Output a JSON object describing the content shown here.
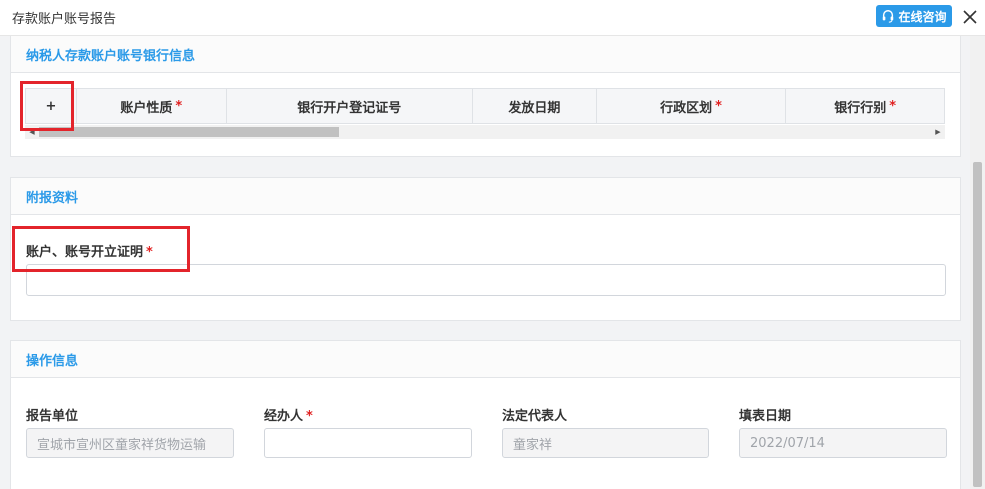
{
  "window": {
    "title": "存款账户账号报告",
    "consult_label": "在线咨询"
  },
  "bank_section": {
    "title": "纳税人存款账户账号银行信息",
    "add_label": "+",
    "columns": [
      {
        "label": "账户性质",
        "required": "*"
      },
      {
        "label": "银行开户登记证号",
        "required": ""
      },
      {
        "label": "发放日期",
        "required": ""
      },
      {
        "label": "行政区划",
        "required": "*"
      },
      {
        "label": "银行行别",
        "required": "*"
      }
    ]
  },
  "attach_section": {
    "title": "附报资料",
    "proof_label": "账户、账号开立证明",
    "proof_required": "*",
    "proof_value": ""
  },
  "op_section": {
    "title": "操作信息",
    "report_unit_label": "报告单位",
    "report_unit_value": "宣城市宣州区童家祥货物运输",
    "handler_label": "经办人",
    "handler_required": "*",
    "handler_value": "",
    "legal_rep_label": "法定代表人",
    "legal_rep_value": "童家祥",
    "fill_date_label": "填表日期",
    "fill_date_value": "2022/07/14"
  },
  "colors": {
    "accent": "#2b9ae8",
    "required": "#e02020",
    "highlight": "#e3242b"
  },
  "icons": [
    "headset-icon",
    "close-icon",
    "plus-icon",
    "arrow-left-icon",
    "arrow-right-icon"
  ]
}
